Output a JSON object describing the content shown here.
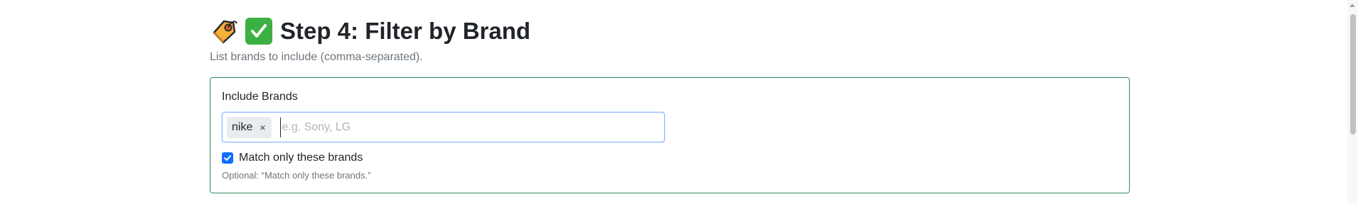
{
  "header": {
    "tag_emoji": "label-icon",
    "check_emoji": "check-mark-button-icon",
    "title": "Step 4: Filter by Brand",
    "subtitle": "List brands to include (comma-separated)."
  },
  "brand_filter": {
    "label": "Include Brands",
    "chips": [
      {
        "label": "nike",
        "remove_symbol": "×"
      }
    ],
    "input_value": "",
    "input_placeholder": "e.g. Sony, LG",
    "match_only": {
      "checked": true,
      "label": "Match only these brands"
    },
    "help_text": "Optional: “Match only these brands.”"
  },
  "colors": {
    "card_border": "#2e8b57",
    "input_focus_border": "#86b7fe",
    "checkbox_accent": "#0d6efd",
    "check_emoji_bg": "#3cb043"
  }
}
